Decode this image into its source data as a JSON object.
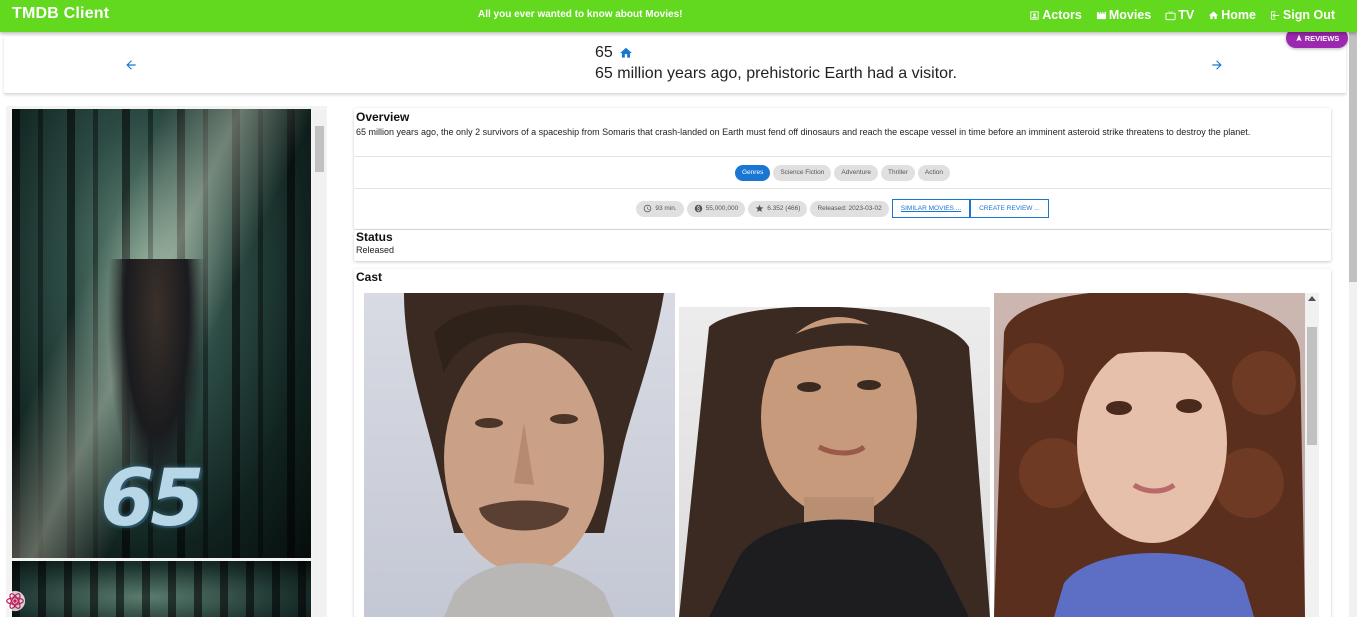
{
  "appbar": {
    "brand": "TMDB Client",
    "tagline": "All you ever wanted to know about Movies!",
    "nav": [
      {
        "label": "Actors",
        "icon": "person-box-icon"
      },
      {
        "label": "Movies",
        "icon": "movie-icon"
      },
      {
        "label": "TV",
        "icon": "tv-icon"
      },
      {
        "label": "Home",
        "icon": "home-icon"
      },
      {
        "label": "Sign Out",
        "icon": "logout-icon"
      }
    ],
    "color": "#62d81f"
  },
  "movie": {
    "title": "65",
    "tagline": "65 million years ago, prehistoric Earth had a visitor.",
    "reviews_label": "REVIEWS",
    "poster_title": "65"
  },
  "overview": {
    "heading": "Overview",
    "text": "65 million years ago, the only 2 survivors of a spaceship from Somaris that crash-landed on Earth must fend off dinosaurs and reach the escape vessel in time before an imminent asteroid strike threatens to destroy the planet."
  },
  "genres": {
    "label": "Genres",
    "items": [
      "Science Fiction",
      "Adventure",
      "Thriller",
      "Action"
    ]
  },
  "stats": {
    "runtime": "93 min.",
    "budget": "55,000,000",
    "rating": "6.352 (466)",
    "released": "Released: 2023-03-02",
    "similar_label": "SIMILAR MOVIES ...",
    "review_label": "CREATE REVIEW ..."
  },
  "status": {
    "heading": "Status",
    "value": "Released"
  },
  "cast": {
    "heading": "Cast"
  },
  "colors": {
    "primary": "#1976d2",
    "accent": "#9c27b0"
  }
}
